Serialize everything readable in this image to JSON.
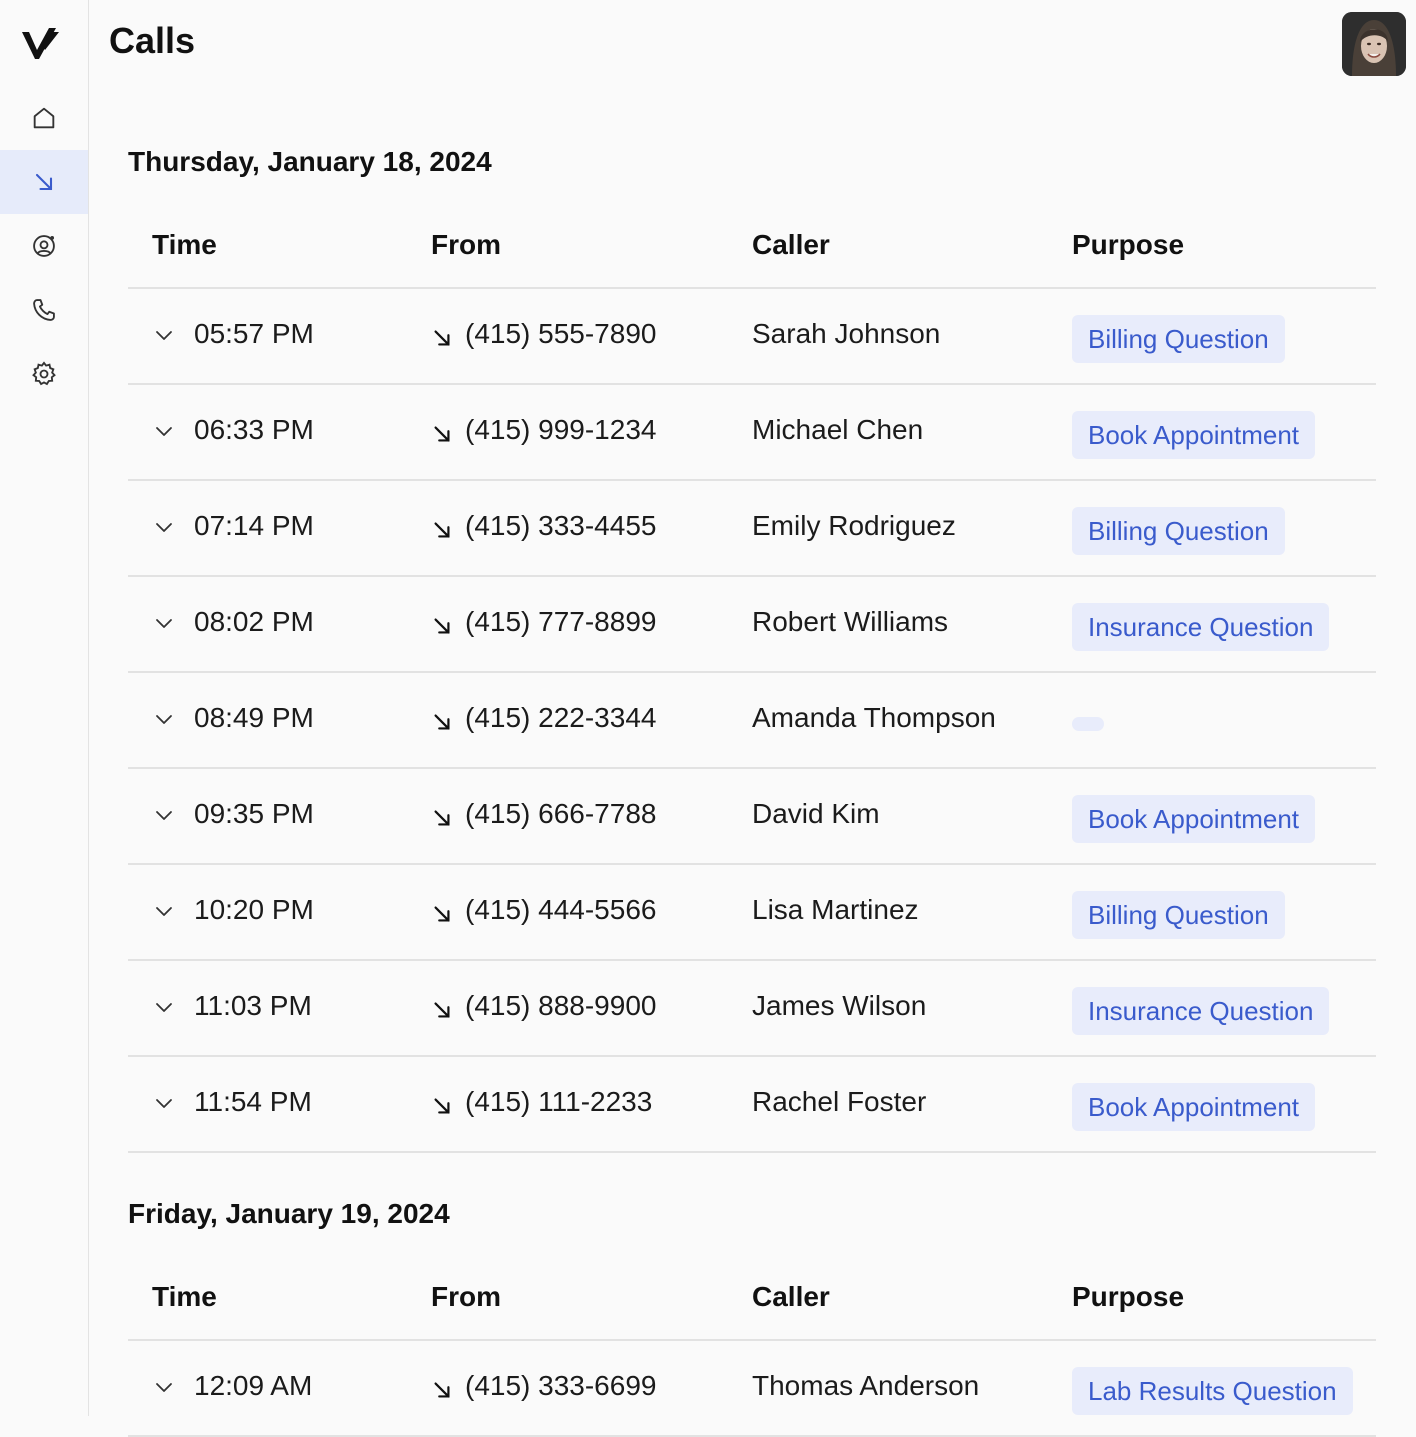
{
  "app": {
    "page_title": "Calls"
  },
  "sidebar": {
    "items": [
      {
        "name": "home",
        "icon": "home-icon"
      },
      {
        "name": "calls",
        "icon": "incoming-call-arrow-icon",
        "active": true
      },
      {
        "name": "contacts",
        "icon": "user-circle-icon"
      },
      {
        "name": "phone",
        "icon": "phone-icon"
      },
      {
        "name": "settings",
        "icon": "gear-icon"
      }
    ]
  },
  "headers": {
    "time": "Time",
    "from": "From",
    "caller": "Caller",
    "purpose": "Purpose"
  },
  "sections": [
    {
      "date": "Thursday, January 18, 2024",
      "rows": [
        {
          "time": "05:57 PM",
          "from": "(415) 555-7890",
          "caller": "Sarah Johnson",
          "purpose": "Billing Question"
        },
        {
          "time": "06:33 PM",
          "from": "(415) 999-1234",
          "caller": "Michael Chen",
          "purpose": "Book Appointment"
        },
        {
          "time": "07:14 PM",
          "from": "(415) 333-4455",
          "caller": "Emily Rodriguez",
          "purpose": "Billing Question"
        },
        {
          "time": "08:02 PM",
          "from": "(415) 777-8899",
          "caller": "Robert Williams",
          "purpose": "Insurance Question"
        },
        {
          "time": "08:49 PM",
          "from": "(415) 222-3344",
          "caller": "Amanda Thompson",
          "purpose": ""
        },
        {
          "time": "09:35 PM",
          "from": "(415) 666-7788",
          "caller": "David Kim",
          "purpose": "Book Appointment"
        },
        {
          "time": "10:20 PM",
          "from": "(415) 444-5566",
          "caller": "Lisa Martinez",
          "purpose": "Billing Question"
        },
        {
          "time": "11:03 PM",
          "from": "(415) 888-9900",
          "caller": "James Wilson",
          "purpose": "Insurance Question"
        },
        {
          "time": "11:54 PM",
          "from": "(415) 111-2233",
          "caller": "Rachel Foster",
          "purpose": "Book Appointment"
        }
      ]
    },
    {
      "date": "Friday, January 19, 2024",
      "rows": [
        {
          "time": "12:09 AM",
          "from": "(415) 333-6699",
          "caller": "Thomas Anderson",
          "purpose": "Lab Results Question"
        }
      ]
    }
  ],
  "colors": {
    "accent": "#3a5bcc",
    "badge_bg": "#e8ecfb",
    "active_nav_bg": "#e6ebfa"
  }
}
